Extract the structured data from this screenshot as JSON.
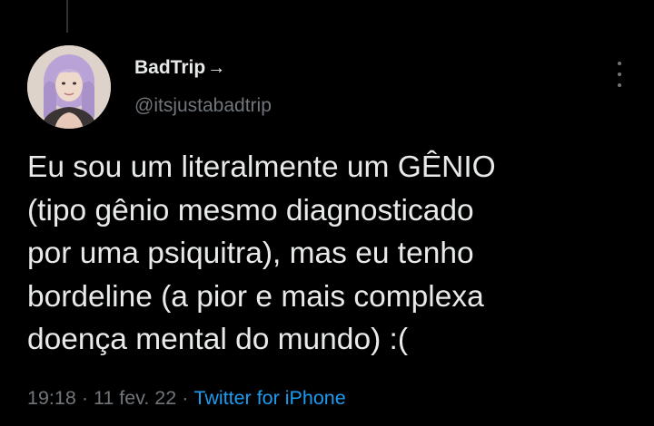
{
  "tweet": {
    "author": {
      "display_name": "BadTrip",
      "name_suffix_icon": "arrow-right-icon",
      "name_suffix_glyph": "→",
      "handle": "@itsjustabadtrip"
    },
    "text": "Eu sou um literalmente um GÊNIO\n(tipo gênio mesmo diagnosticado\npor uma psiquitra), mas eu tenho\nbordeline (a pior e mais complexa\ndoença mental do mundo) :(",
    "time": "19:18",
    "date": "11 fev. 22",
    "separator": "·",
    "source": "Twitter for iPhone"
  },
  "colors": {
    "background": "#000000",
    "primary_text": "#e7e9ea",
    "secondary_text": "#71767b",
    "link": "#1d9bf0"
  }
}
